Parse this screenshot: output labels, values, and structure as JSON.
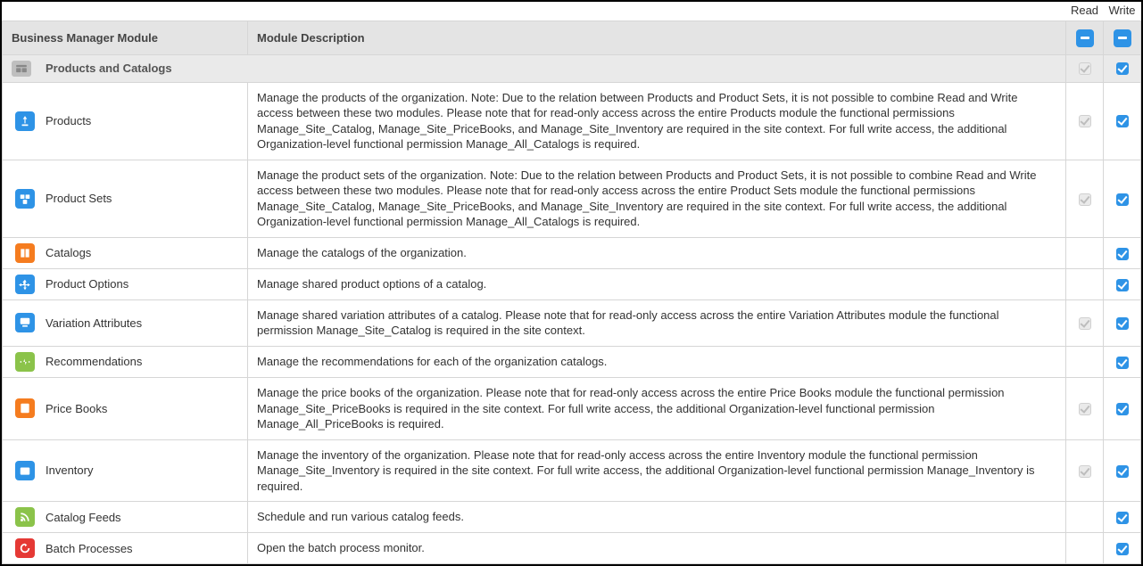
{
  "headers": {
    "module": "Business Manager Module",
    "description": "Module Description",
    "read": "Read",
    "write": "Write"
  },
  "section": {
    "name": "Products and Catalogs",
    "read": {
      "present": true,
      "checked": true,
      "disabled": true
    },
    "write": {
      "present": true,
      "checked": true,
      "disabled": false
    }
  },
  "modules": [
    {
      "name": "Products",
      "icon": "product",
      "color": "blue",
      "description": "Manage the products of the organization. Note: Due to the relation between Products and Product Sets, it is not possible to combine Read and Write access between these two modules. Please note that for read-only access across the entire Products module the functional permissions Manage_Site_Catalog, Manage_Site_PriceBooks, and Manage_Site_Inventory are required in the site context. For full write access, the additional Organization-level functional permission Manage_All_Catalogs is required.",
      "read": {
        "present": true,
        "checked": true,
        "disabled": true
      },
      "write": {
        "present": true,
        "checked": true,
        "disabled": false
      }
    },
    {
      "name": "Product Sets",
      "icon": "product-sets",
      "color": "blue",
      "description": "Manage the product sets of the organization. Note: Due to the relation between Products and Product Sets, it is not possible to combine Read and Write access between these two modules. Please note that for read-only access across the entire Product Sets module the functional permissions Manage_Site_Catalog, Manage_Site_PriceBooks, and Manage_Site_Inventory are required in the site context. For full write access, the additional Organization-level functional permission Manage_All_Catalogs is required.",
      "read": {
        "present": true,
        "checked": true,
        "disabled": true
      },
      "write": {
        "present": true,
        "checked": true,
        "disabled": false
      }
    },
    {
      "name": "Catalogs",
      "icon": "catalog",
      "color": "orange",
      "description": "Manage the catalogs of the organization.",
      "read": {
        "present": false
      },
      "write": {
        "present": true,
        "checked": true,
        "disabled": false
      }
    },
    {
      "name": "Product Options",
      "icon": "product-options",
      "color": "blue",
      "description": "Manage shared product options of a catalog.",
      "read": {
        "present": false
      },
      "write": {
        "present": true,
        "checked": true,
        "disabled": false
      }
    },
    {
      "name": "Variation Attributes",
      "icon": "variation",
      "color": "blue",
      "description": "Manage shared variation attributes of a catalog. Please note that for read-only access across the entire Variation Attributes module the functional permission Manage_Site_Catalog is required in the site context.",
      "read": {
        "present": true,
        "checked": true,
        "disabled": true
      },
      "write": {
        "present": true,
        "checked": true,
        "disabled": false
      }
    },
    {
      "name": "Recommendations",
      "icon": "recommend",
      "color": "green",
      "description": "Manage the recommendations for each of the organization catalogs.",
      "read": {
        "present": false
      },
      "write": {
        "present": true,
        "checked": true,
        "disabled": false
      }
    },
    {
      "name": "Price Books",
      "icon": "pricebook",
      "color": "orange",
      "description": "Manage the price books of the organization. Please note that for read-only access across the entire Price Books module the functional permission Manage_Site_PriceBooks is required in the site context. For full write access, the additional Organization-level functional permission Manage_All_PriceBooks is required.",
      "read": {
        "present": true,
        "checked": true,
        "disabled": true
      },
      "write": {
        "present": true,
        "checked": true,
        "disabled": false
      }
    },
    {
      "name": "Inventory",
      "icon": "inventory",
      "color": "blue",
      "description": "Manage the inventory of the organization. Please note that for read-only access across the entire Inventory module the functional permission Manage_Site_Inventory is required in the site context. For full write access, the additional Organization-level functional permission Manage_Inventory is required.",
      "read": {
        "present": true,
        "checked": true,
        "disabled": true
      },
      "write": {
        "present": true,
        "checked": true,
        "disabled": false
      }
    },
    {
      "name": "Catalog Feeds",
      "icon": "feeds",
      "color": "green",
      "description": "Schedule and run various catalog feeds.",
      "read": {
        "present": false
      },
      "write": {
        "present": true,
        "checked": true,
        "disabled": false
      }
    },
    {
      "name": "Batch Processes",
      "icon": "batch",
      "color": "red",
      "description": "Open the batch process monitor.",
      "read": {
        "present": false
      },
      "write": {
        "present": true,
        "checked": true,
        "disabled": false
      }
    }
  ]
}
